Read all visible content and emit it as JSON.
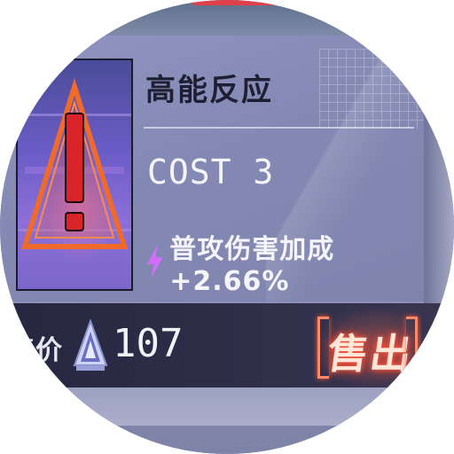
{
  "item": {
    "name": "高能反应",
    "cost": "COST 3",
    "effect": "普攻伤害加成 +2.66%",
    "icon": "warning-triangle-icon"
  },
  "price": {
    "label": "售价",
    "currency_icon": "crystal-icon",
    "value": "107"
  },
  "actions": {
    "sell_label": "售出"
  },
  "colors": {
    "card_bg": "#8a8fba",
    "icon_bg": "#6b5cc6",
    "warning_red": "#e23b33",
    "effect_bolt": "#d36cff",
    "sell_glow": "#ff5a3c",
    "bottom_bar": "#2a2a44"
  }
}
